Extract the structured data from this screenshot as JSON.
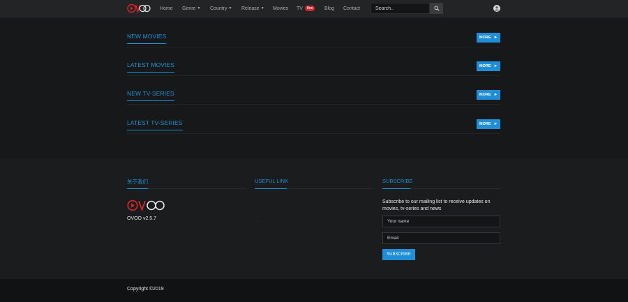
{
  "brand": {
    "logo_text": "OVOO"
  },
  "nav": {
    "items": [
      {
        "label": "Home",
        "dropdown": false
      },
      {
        "label": "Genre",
        "dropdown": true
      },
      {
        "label": "Country",
        "dropdown": true
      },
      {
        "label": "Release",
        "dropdown": true
      },
      {
        "label": "Movies",
        "dropdown": false
      },
      {
        "label": "TV",
        "dropdown": false,
        "badge": "live"
      },
      {
        "label": "Blog",
        "dropdown": false
      },
      {
        "label": "Contact",
        "dropdown": false
      }
    ]
  },
  "search": {
    "placeholder": "Search..",
    "icon": "search-icon"
  },
  "user": {
    "icon": "user-icon"
  },
  "sections": [
    {
      "title": "NEW MOVIES",
      "button": "MORE"
    },
    {
      "title": "LATEST MOVIES",
      "button": "MORE"
    },
    {
      "title": "NEW TV-SERIES",
      "button": "MORE"
    },
    {
      "title": "LATEST TV-SERIES",
      "button": "MORE"
    }
  ],
  "footer": {
    "about_title": "关于我们",
    "useful_title": "USEFUL LINK",
    "subscribe_title": "SUBSCRIBE",
    "version": "OVOO v2.5.7",
    "subscribe_text": "Subscribe to our mailing list to receive updates on movies, tv-series and news",
    "name_placeholder": "Your name",
    "email_placeholder": "Email",
    "subscribe_button": "SUBSCRIBE"
  },
  "copyright": "Copyright ©2019",
  "colors": {
    "accent": "#1a93d9",
    "button": "#1f8ed8",
    "brand_red": "#d9252b",
    "background": "#171819"
  }
}
